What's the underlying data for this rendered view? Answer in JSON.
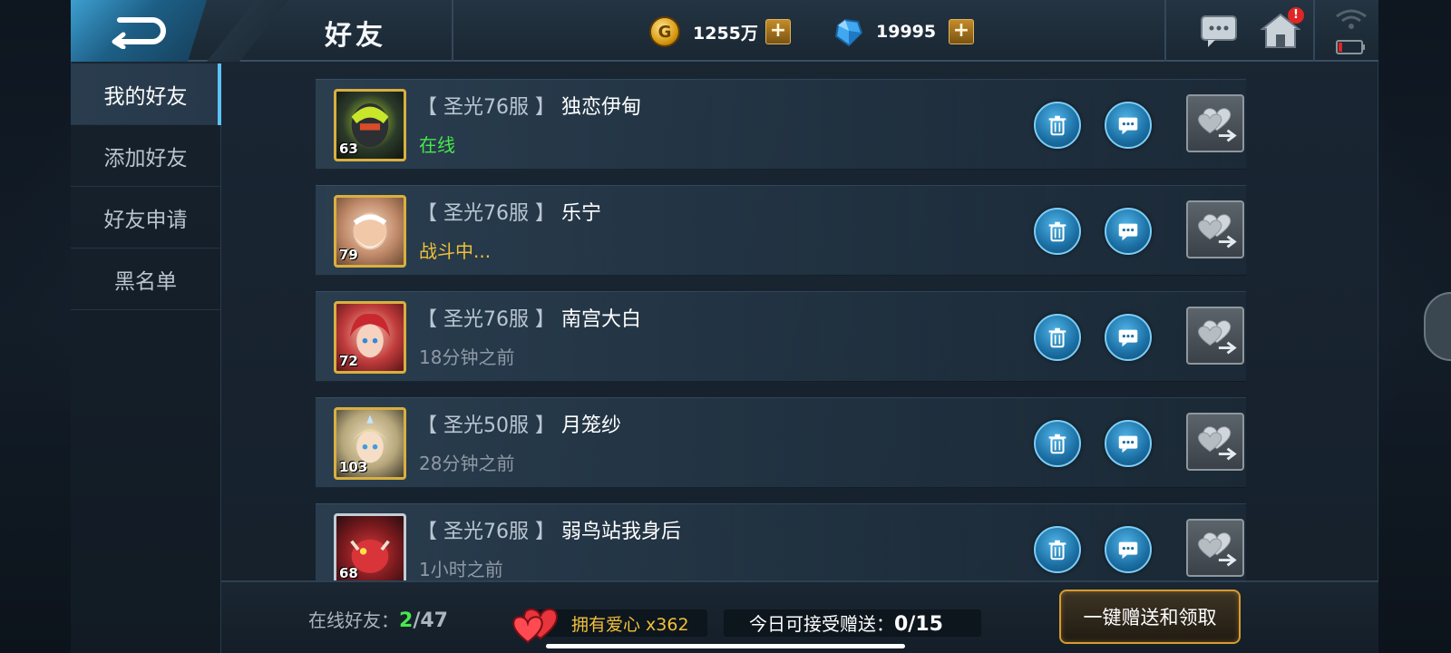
{
  "header": {
    "title": "好友",
    "gold": {
      "icon": "gold-coin-icon",
      "value": "1255万",
      "add_label": "+"
    },
    "gems": {
      "icon": "diamond-icon",
      "value": "19995",
      "add_label": "+"
    },
    "icons": [
      "back-arrow-icon",
      "chat-icon",
      "home-icon",
      "wifi-icon",
      "battery-icon"
    ],
    "home_badge": "!"
  },
  "sidebar": {
    "items": [
      {
        "label": "我的好友",
        "active": true
      },
      {
        "label": "添加好友",
        "active": false
      },
      {
        "label": "好友申请",
        "active": false
      },
      {
        "label": "黑名单",
        "active": false
      }
    ]
  },
  "friends": [
    {
      "server": "【 圣光76服 】",
      "name": "独恋伊甸",
      "level": "63",
      "status": "在线",
      "status_type": "online"
    },
    {
      "server": "【 圣光76服 】",
      "name": "乐宁",
      "level": "79",
      "status": "战斗中...",
      "status_type": "battle"
    },
    {
      "server": "【 圣光76服 】",
      "name": "南宫大白",
      "level": "72",
      "status": "18分钟之前",
      "status_type": "offline"
    },
    {
      "server": "【 圣光50服 】",
      "name": "月笼纱",
      "level": "103",
      "status": "28分钟之前",
      "status_type": "offline"
    },
    {
      "server": "【 圣光76服 】",
      "name": "弱鸟站我身后",
      "level": "68",
      "status": "1小时之前",
      "status_type": "offline"
    }
  ],
  "footer": {
    "online_label": "在线好友：",
    "online_count": "2",
    "online_total": "/47",
    "hearts_label": "拥有爱心 x362",
    "gift_limit_label": "今日可接受赠送：",
    "gift_limit_value": "0/15",
    "oneclick_label": "一键赠送和领取"
  },
  "colors": {
    "online": "#48e84c",
    "battle": "#f0c039",
    "accent": "#5cc4f5",
    "gold_border": "#d89b2f"
  }
}
